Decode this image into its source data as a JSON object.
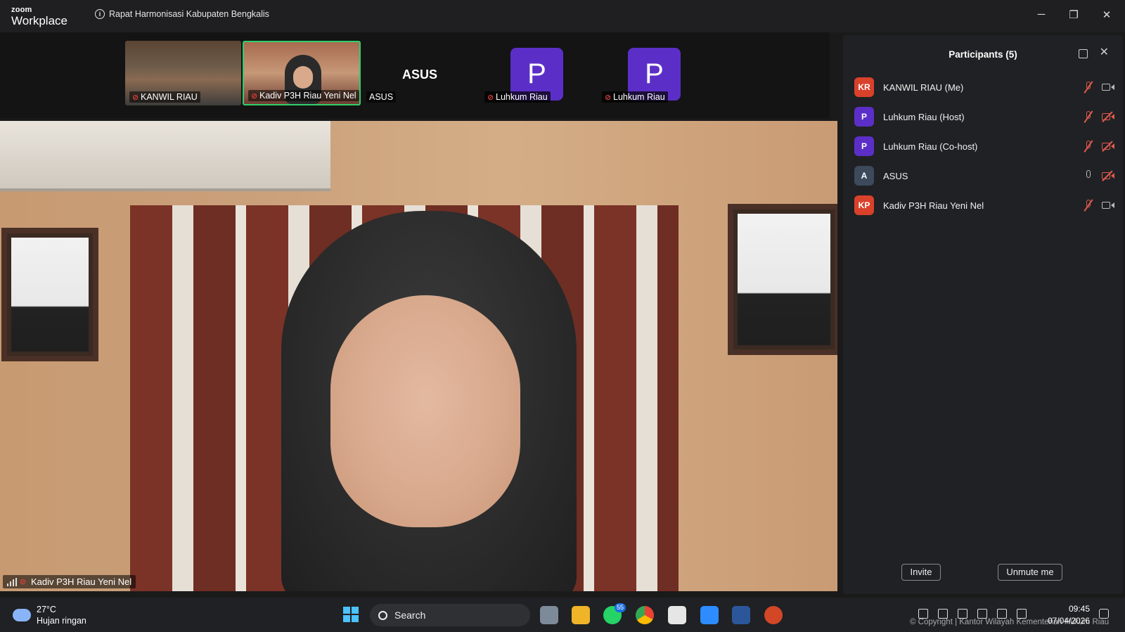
{
  "app": {
    "logo_top": "zoom",
    "logo_bottom": "Workplace",
    "meeting_title": "Rapat Harmonisasi Kabupaten Bengkalis"
  },
  "window_controls": {
    "minimize": "─",
    "restore": "❐",
    "close": "✕"
  },
  "thumbnails": [
    {
      "name": "KANWIL RIAU",
      "muted": true
    },
    {
      "name": "Kadiv P3H Riau Yeni Nel",
      "muted": true,
      "active": true
    },
    {
      "name": "ASUS",
      "muted": false,
      "display": "ASUS"
    },
    {
      "name": "Luhkum Riau",
      "muted": true,
      "avatar": "P"
    },
    {
      "name": "Luhkum Riau",
      "muted": true,
      "avatar": "P"
    }
  ],
  "main_video": {
    "label": "Kadiv P3H Riau Yeni Nel"
  },
  "participants": {
    "title": "Participants (5)",
    "list": [
      {
        "initials": "KR",
        "name": "KANWIL RIAU (Me)",
        "avatar_color": "#d9412b",
        "mic_muted": true,
        "video_off": false
      },
      {
        "initials": "P",
        "name": "Luhkum Riau (Host)",
        "avatar_color": "#5b2fc7",
        "mic_muted": true,
        "video_off": true
      },
      {
        "initials": "P",
        "name": "Luhkum Riau (Co-host)",
        "avatar_color": "#5b2fc7",
        "mic_muted": true,
        "video_off": true
      },
      {
        "initials": "A",
        "name": "ASUS",
        "avatar_color": "#3c4a5c",
        "mic_muted": false,
        "video_off": true
      },
      {
        "initials": "KP",
        "name": "Kadiv P3H Riau Yeni Nel",
        "avatar_color": "#d9412b",
        "mic_muted": true,
        "video_off": false
      }
    ],
    "invite_label": "Invite",
    "unmute_label": "Unmute me"
  },
  "taskbar": {
    "temperature": "27°C",
    "weather_desc": "Hujan ringan",
    "search_placeholder": "Search",
    "whatsapp_badge": "55",
    "time": "09:45",
    "date": "07/04/2026"
  },
  "watermark": "© Copyright | Kantor Wilayah Kementerian Hukum Riau",
  "colors": {
    "accent_green": "#2fd06a",
    "muted_red": "#e05a4e",
    "avatar_purple": "#5b2fc7"
  }
}
